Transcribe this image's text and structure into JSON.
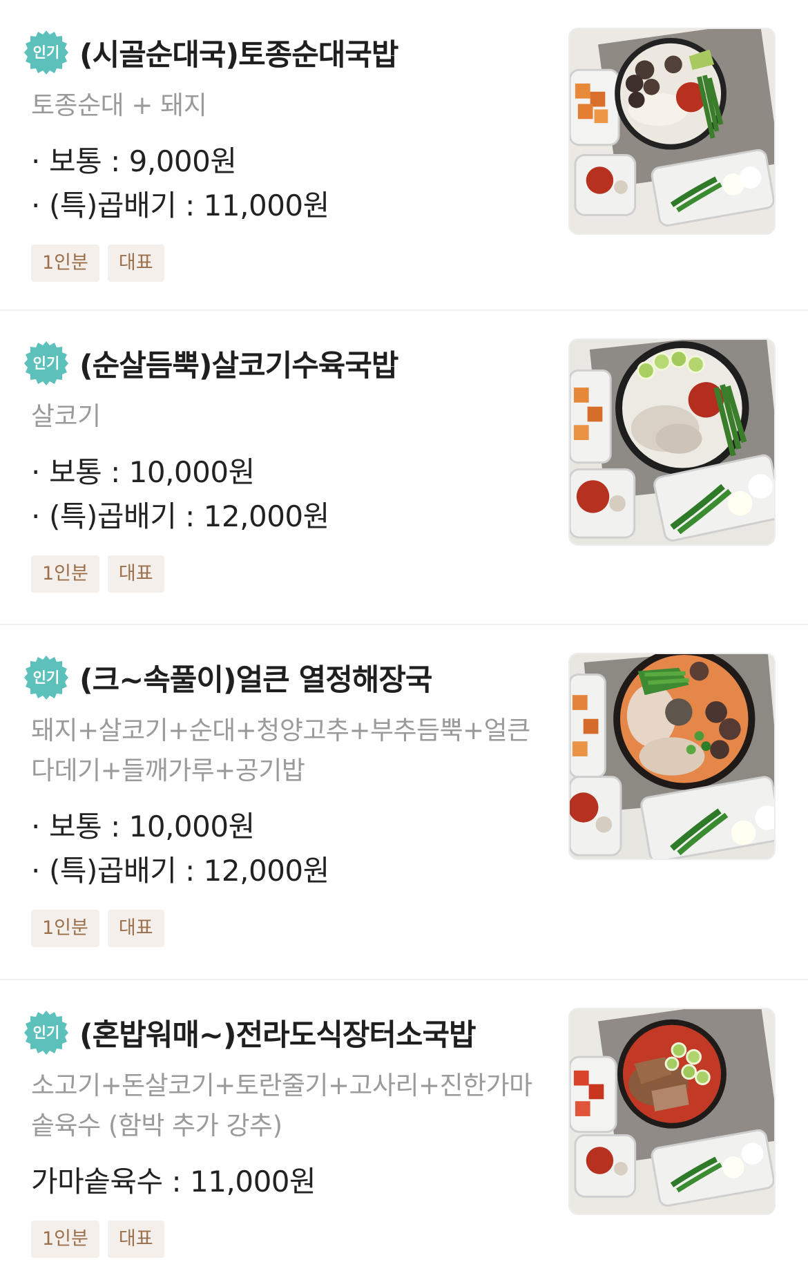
{
  "badge_label": "인기",
  "colors": {
    "badge_teal": "#5cc0bb",
    "tag_bg": "#f4efea",
    "tag_text": "#9a6f4c",
    "desc_gray": "#9a9a9a"
  },
  "menu_items": [
    {
      "name": "(시골순대국)토종순대국밥",
      "description": "토종순대 + 돼지",
      "prices": [
        "보통 : 9,000원",
        "(특)곱배기 : 11,000원"
      ],
      "tags": [
        "1인분",
        "대표"
      ],
      "photo_icon": "sundae-gukbap-photo"
    },
    {
      "name": "(순살듬뿍)살코기수육국밥",
      "description": "살코기",
      "prices": [
        "보통 : 10,000원",
        "(특)곱배기 : 12,000원"
      ],
      "tags": [
        "1인분",
        "대표"
      ],
      "photo_icon": "suyuk-gukbap-photo"
    },
    {
      "name": "(크~속풀이)얼큰 열정해장국",
      "description": "돼지+살코기+순대+청양고추+부추듬뿍+얼큰다데기+들깨가루+공기밥",
      "prices": [
        "보통 : 10,000원",
        "(특)곱배기 : 12,000원"
      ],
      "tags": [
        "1인분",
        "대표"
      ],
      "photo_icon": "haejangguk-photo"
    },
    {
      "name": "(혼밥워매~)전라도식장터소국밥",
      "description": "소고기+돈살코기+토란줄기+고사리+진한가마솥육수 (함박 추가 강추)",
      "prices": [
        "가마솥육수 : 11,000원"
      ],
      "tags": [
        "1인분",
        "대표"
      ],
      "photo_icon": "sogukbap-photo"
    }
  ]
}
